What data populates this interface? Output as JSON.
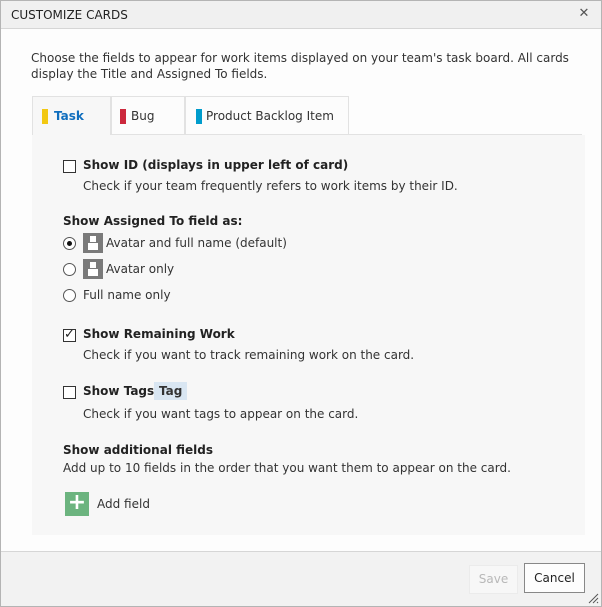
{
  "dialog": {
    "title": "CUSTOMIZE CARDS",
    "close_icon": "close-icon",
    "intro": "Choose the fields to appear for work items displayed on your team's task board. All cards display the Title and Assigned To fields."
  },
  "tabs": [
    {
      "label": "Task",
      "color": "#f2c811",
      "active": true
    },
    {
      "label": "Bug",
      "color": "#cc293d",
      "active": false
    },
    {
      "label": "Product Backlog Item",
      "color": "#009ccc",
      "active": false
    }
  ],
  "options": {
    "show_id": {
      "label": "Show ID (displays in upper left of card)",
      "description": "Check if your team frequently refers to work items by their ID.",
      "checked": false
    },
    "assigned_to": {
      "heading": "Show Assigned To field as:",
      "choices": [
        {
          "label": "Avatar and full name (default)",
          "selected": true,
          "icon": "avatar-icon"
        },
        {
          "label": "Avatar only",
          "selected": false,
          "icon": "avatar-icon"
        },
        {
          "label": "Full name only",
          "selected": false
        }
      ]
    },
    "remaining_work": {
      "label": "Show Remaining Work",
      "description": "Check if you want to track remaining work on the card.",
      "checked": true
    },
    "tags": {
      "label": "Show Tags",
      "chip": "Tag",
      "description": "Check if you want tags to appear on the card.",
      "checked": false
    },
    "additional": {
      "heading": "Show additional fields",
      "description": "Add up to 10 fields in the order that you want them to appear on the card.",
      "add_label": "Add field"
    }
  },
  "footer": {
    "save_label": "Save",
    "cancel_label": "Cancel",
    "save_enabled": false
  }
}
